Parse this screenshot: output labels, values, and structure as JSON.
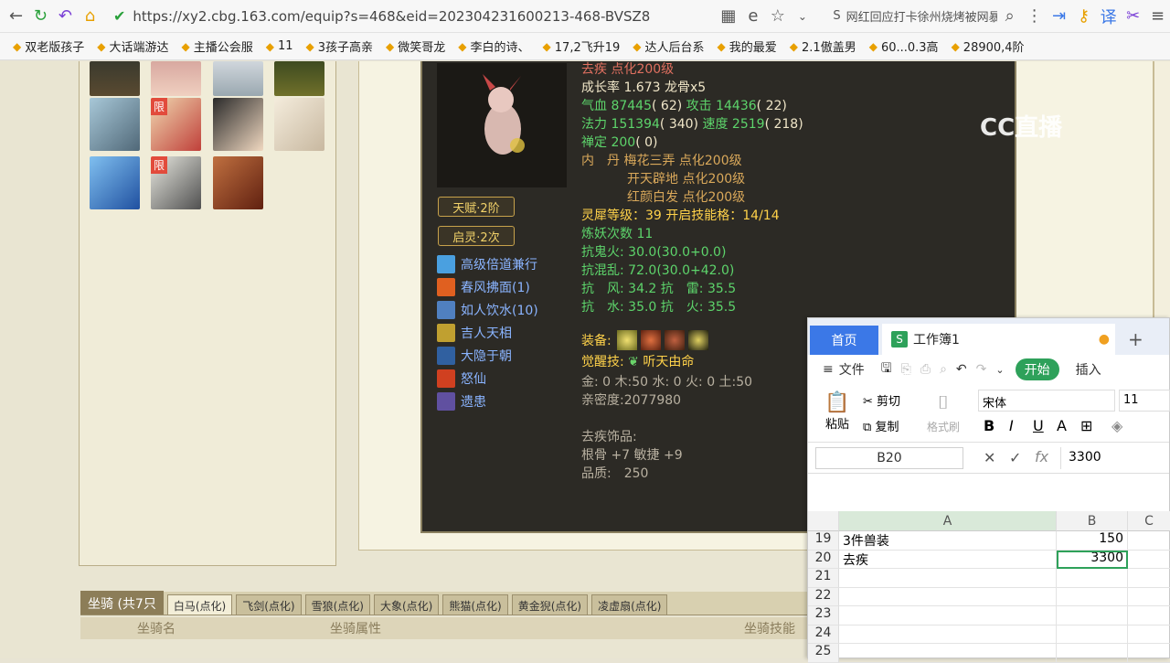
{
  "browser": {
    "url": "https://xy2.cbg.163.com/equip?s=468&eid=202304231600213-468-BVSZ8",
    "news_ticker": "网红回应打卡徐州烧烤被网暴"
  },
  "bookmarks": [
    "双老版孩子",
    "大话端游达",
    "主播公会服",
    "11",
    "3孩子高亲",
    "微笑哥龙",
    "李白的诗、",
    "17,2飞升19",
    "达人后台系",
    "我的最爱",
    "2.1傲盖男",
    "60...0.3高",
    "28900,4阶"
  ],
  "pet": {
    "line1": "去疾 点化200级",
    "growth": "成长率 1.673 龙骨x5",
    "hp_label": "气血",
    "hp": "87445",
    "hp_extra": "( 62)",
    "atk_label": "攻击",
    "atk": "14436",
    "atk_extra": "( 22)",
    "mp_label": "法力",
    "mp": "151394",
    "mp_extra": "( 340)",
    "spd_label": "速度",
    "spd": "2519",
    "spd_extra": "( 218)",
    "zen_label": "禅定",
    "zen": "200",
    "zen_extra": "( 0)",
    "dan_label": "内　丹",
    "dan1": "梅花三弄 点化200级",
    "dan2": "开天辟地 点化200级",
    "dan3": "红颜白发 点化200级",
    "lingxi": "灵犀等级：39 开启技能格：14/14",
    "lianyao": "炼妖次数 11",
    "res1": "抗鬼火: 30.0(30.0+0.0)",
    "res2": "抗混乱: 72.0(30.0+42.0)",
    "res3": "抗　风: 34.2 抗　雷: 35.5",
    "res4": "抗　水: 35.0 抗　火: 35.5",
    "equip_label": "装备:",
    "awake_label": "觉醒技:",
    "awake": "听天由命",
    "elements": "金: 0 木:50 水: 0 火: 0 土:50",
    "intimacy": "亲密度:2077980",
    "acc_label": "去疾饰品:",
    "acc_stats": "根骨 +7 敏捷 +9",
    "quality": "品质:　250"
  },
  "tags": {
    "talent": "天赋·2阶",
    "spirit": "启灵·2次"
  },
  "skills": [
    "高级倍道兼行",
    "春风拂面(1)",
    "如人饮水(10)",
    "吉人天相",
    "大隐于朝",
    "怒仙",
    "遗患"
  ],
  "avatars": {
    "limited_label": "限"
  },
  "mounts": {
    "title": "坐骑 (共7只",
    "tabs": [
      "白马(点化)",
      "飞剑(点化)",
      "雪狼(点化)",
      "大象(点化)",
      "熊猫(点化)",
      "黄金猊(点化)",
      "凌虚扇(点化)"
    ],
    "col_name": "坐骑名",
    "col_attr": "坐骑属性",
    "col_skill": "坐骑技能"
  },
  "wps": {
    "home_tab": "首页",
    "book_tab": "工作簿1",
    "menu_file": "文件",
    "menu_start": "开始",
    "menu_insert": "插入",
    "cut": "剪切",
    "paste": "粘贴",
    "copy": "复制",
    "format_painter": "格式刷",
    "font": "宋体",
    "font_size": "11",
    "cell_ref": "B20",
    "formula_value": "3300",
    "col_a": "A",
    "col_b": "B",
    "col_c": "C",
    "rows": [
      {
        "n": "19",
        "a": "3件兽装",
        "b": "150"
      },
      {
        "n": "20",
        "a": "去疾",
        "b": "3300"
      },
      {
        "n": "21",
        "a": "",
        "b": ""
      },
      {
        "n": "22",
        "a": "",
        "b": ""
      },
      {
        "n": "23",
        "a": "",
        "b": ""
      },
      {
        "n": "24",
        "a": "",
        "b": ""
      },
      {
        "n": "25",
        "a": "",
        "b": ""
      }
    ]
  },
  "watermark": "CC直播"
}
